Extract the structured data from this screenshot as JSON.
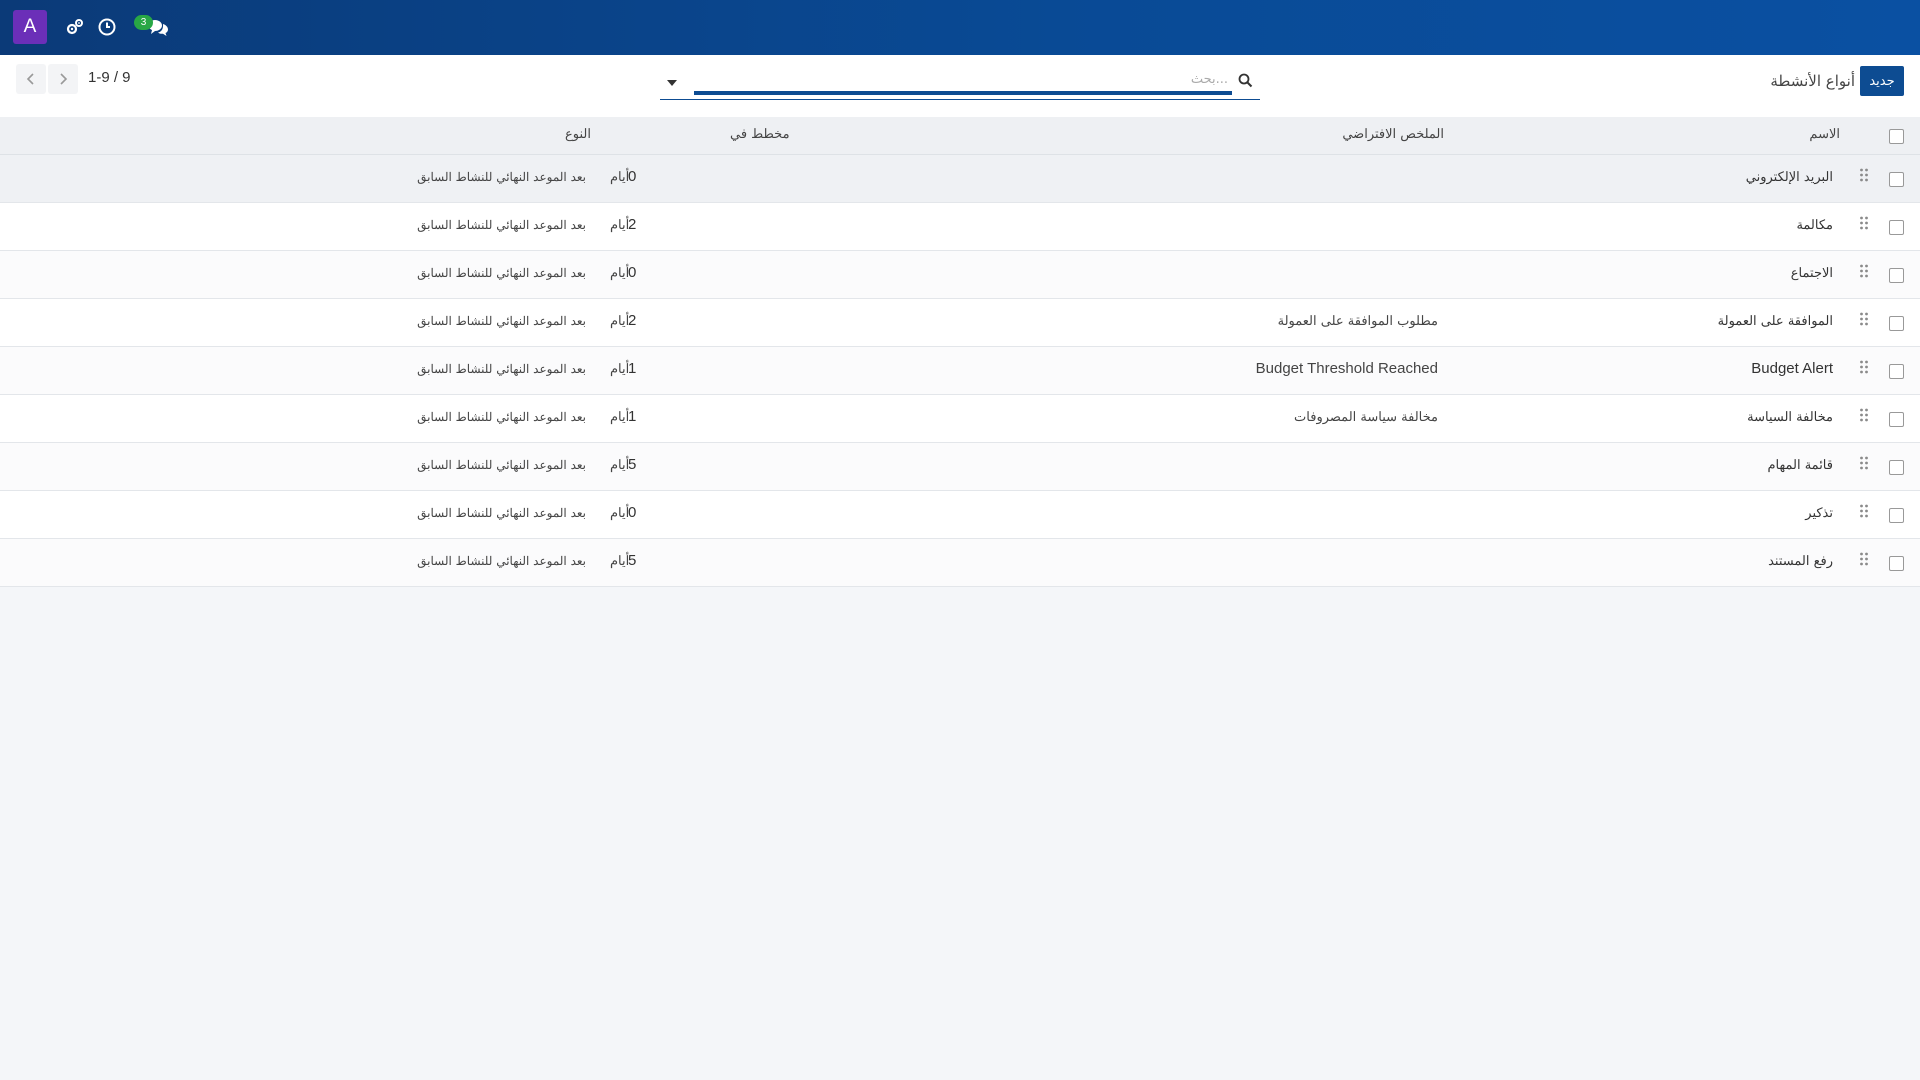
{
  "navbar": {
    "avatar_letter": "A",
    "messages_badge": "3",
    "accent_color": "#0b3a78"
  },
  "control_panel": {
    "new_button_label": "جديد",
    "breadcrumb_title": "أنواع الأنشطة",
    "search_placeholder": "بحث...",
    "pager_value": "1-9 / 9"
  },
  "table": {
    "headers": {
      "name": "الاسم",
      "summary": "الملخص الافتراضي",
      "planned_in": "مخطط في",
      "type": "النوع"
    },
    "rows": [
      {
        "name": "البريد الإلكتروني",
        "summary": "",
        "num": "0",
        "unit": "أيام",
        "type": "بعد الموعد النهائي للنشاط السابق"
      },
      {
        "name": "مكالمة",
        "summary": "",
        "num": "2",
        "unit": "أيام",
        "type": "بعد الموعد النهائي للنشاط السابق"
      },
      {
        "name": "الاجتماع",
        "summary": "",
        "num": "0",
        "unit": "أيام",
        "type": "بعد الموعد النهائي للنشاط السابق"
      },
      {
        "name": "الموافقة على العمولة",
        "summary": "مطلوب الموافقة على العمولة",
        "num": "2",
        "unit": "أيام",
        "type": "بعد الموعد النهائي للنشاط السابق"
      },
      {
        "name": "Budget Alert",
        "summary": "Budget Threshold Reached",
        "num": "1",
        "unit": "أيام",
        "type": "بعد الموعد النهائي للنشاط السابق"
      },
      {
        "name": "مخالفة السياسة",
        "summary": "مخالفة سياسة المصروفات",
        "num": "1",
        "unit": "أيام",
        "type": "بعد الموعد النهائي للنشاط السابق"
      },
      {
        "name": "قائمة المهام",
        "summary": "",
        "num": "5",
        "unit": "أيام",
        "type": "بعد الموعد النهائي للنشاط السابق"
      },
      {
        "name": "تذكير",
        "summary": "",
        "num": "0",
        "unit": "أيام",
        "type": "بعد الموعد النهائي للنشاط السابق"
      },
      {
        "name": "رفع المستند",
        "summary": "",
        "num": "5",
        "unit": "أيام",
        "type": "بعد الموعد النهائي للنشاط السابق"
      }
    ]
  }
}
